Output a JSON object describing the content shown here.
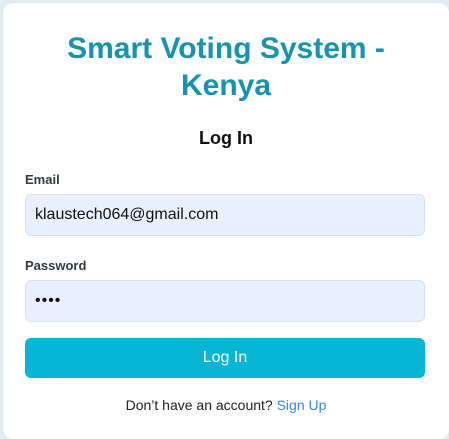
{
  "app": {
    "title": "Smart Voting System - Kenya"
  },
  "form": {
    "title": "Log In",
    "email": {
      "label": "Email",
      "value": "klaustech064@gmail.com"
    },
    "password": {
      "label": "Password",
      "value": "abcd"
    },
    "submit_label": "Log In"
  },
  "signup": {
    "prompt": "Don’t have an account?",
    "link_label": "Sign Up"
  },
  "colors": {
    "title": "#1593b0",
    "button": "#06b6d4",
    "link": "#3b82f6",
    "field_bg": "#e8f0fe"
  }
}
